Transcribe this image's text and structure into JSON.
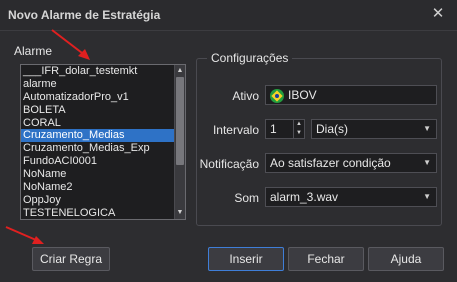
{
  "window": {
    "title": "Novo Alarme de Estratégia",
    "close_icon": "close-icon"
  },
  "alarm": {
    "legend": "Alarme",
    "items": [
      "___IFR_dolar_testemkt",
      "alarme",
      "AutomatizadorPro_v1",
      "BOLETA",
      "CORAL",
      "Cruzamento_Medias",
      "Cruzamento_Medias_Exp",
      "FundoACI0001",
      "NoName",
      "NoName2",
      "OppJoy",
      "TESTENELOGICA"
    ],
    "selected_index": 5
  },
  "config": {
    "legend": "Configurações",
    "ativo_label": "Ativo",
    "ativo_value": "IBOV",
    "intervalo_label": "Intervalo",
    "intervalo_value": "1",
    "intervalo_unit": "Dia(s)",
    "notificacao_label": "Notificação",
    "notificacao_value": "Ao satisfazer condição",
    "som_label": "Som",
    "som_value": "alarm_3.wav"
  },
  "buttons": {
    "criar_regra": "Criar Regra",
    "inserir": "Inserir",
    "fechar": "Fechar",
    "ajuda": "Ajuda"
  },
  "colors": {
    "selection": "#2e72c6",
    "arrow": "#e02020",
    "primary_border": "#3f7ed8"
  }
}
